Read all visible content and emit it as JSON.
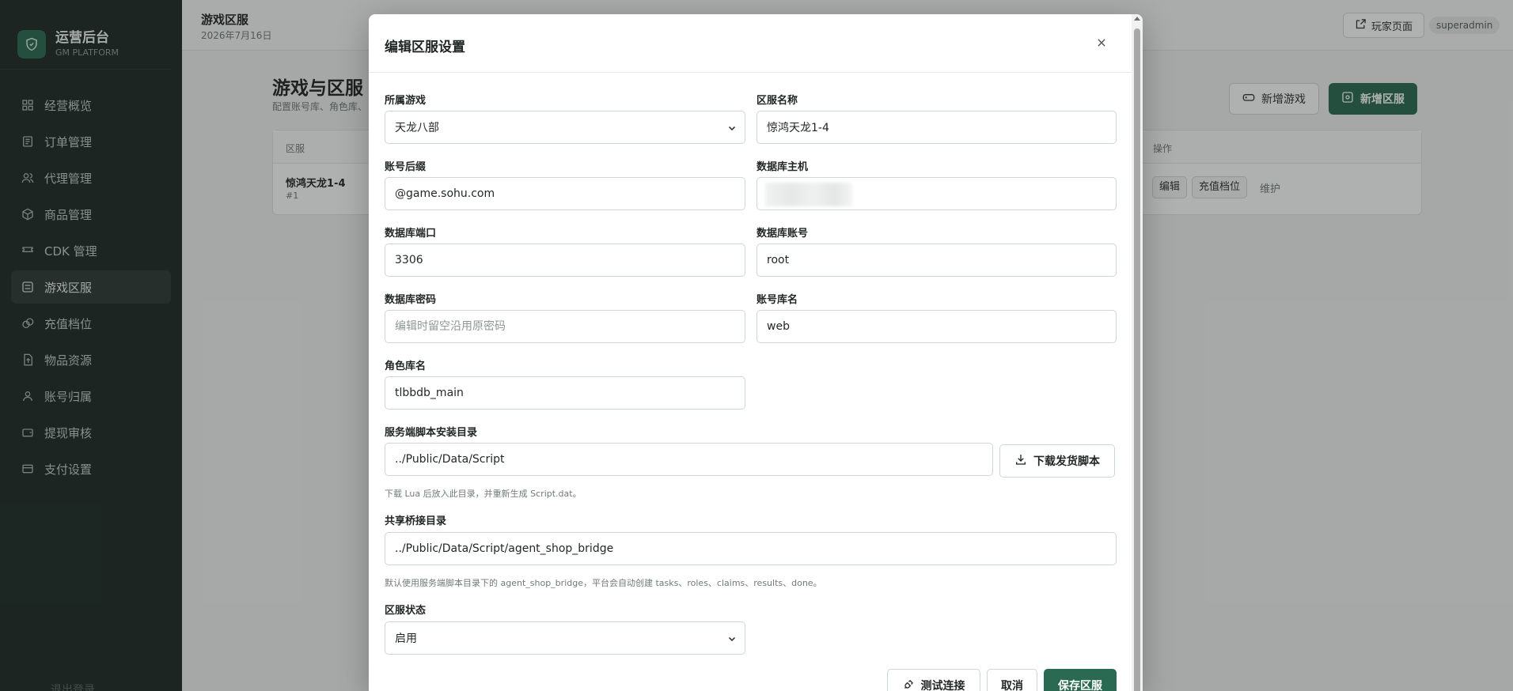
{
  "brand": {
    "title": "运营后台",
    "subtitle": "GM PLATFORM"
  },
  "sidebar": {
    "items": [
      {
        "label": "经营概览",
        "icon": "dashboard-icon"
      },
      {
        "label": "订单管理",
        "icon": "order-icon"
      },
      {
        "label": "代理管理",
        "icon": "users-icon"
      },
      {
        "label": "商品管理",
        "icon": "box-icon"
      },
      {
        "label": "CDK 管理",
        "icon": "ticket-icon"
      },
      {
        "label": "游戏区服",
        "icon": "server-icon",
        "active": true
      },
      {
        "label": "充值档位",
        "icon": "coin-icon"
      },
      {
        "label": "物品资源",
        "icon": "file-icon"
      },
      {
        "label": "账号归属",
        "icon": "user-icon"
      },
      {
        "label": "提现审核",
        "icon": "wallet-icon"
      },
      {
        "label": "支付设置",
        "icon": "card-icon"
      }
    ],
    "logout": "退出登录"
  },
  "header": {
    "title": "游戏区服",
    "date": "2026年7月16日",
    "player_page": "玩家页面",
    "user": "superadmin"
  },
  "page": {
    "title": "游戏与区服",
    "desc": "配置账号库、角色库、",
    "btn_new_game": "新增游戏",
    "btn_new_zone": "新增区服",
    "table": {
      "col_zone": "区服",
      "col_ops": "操作",
      "row": {
        "name": "惊鸿天龙1-4",
        "id": "#1",
        "op_edit": "编辑",
        "op_recharge": "充值档位",
        "op_maintain": "维护"
      }
    }
  },
  "modal": {
    "title": "编辑区服设置",
    "fields": {
      "game": {
        "label": "所属游戏",
        "value": "天龙八部"
      },
      "zone_name": {
        "label": "区服名称",
        "value": "惊鸿天龙1-4"
      },
      "account_suffix": {
        "label": "账号后缀",
        "value": "@game.sohu.com"
      },
      "db_host": {
        "label": "数据库主机",
        "value": ""
      },
      "db_port": {
        "label": "数据库端口",
        "value": "3306"
      },
      "db_user": {
        "label": "数据库账号",
        "value": "root"
      },
      "db_password": {
        "label": "数据库密码",
        "value": "",
        "placeholder": "编辑时留空沿用原密码"
      },
      "account_db": {
        "label": "账号库名",
        "value": "web"
      },
      "role_db": {
        "label": "角色库名",
        "value": "tlbbdb_main"
      },
      "script_dir": {
        "label": "服务端脚本安装目录",
        "value": "../Public/Data/Script",
        "hint": "下载 Lua 后放入此目录，并重新生成 Script.dat。"
      },
      "bridge_dir": {
        "label": "共享桥接目录",
        "value": "../Public/Data/Script/agent_shop_bridge",
        "hint": "默认使用服务端脚本目录下的 agent_shop_bridge，平台会自动创建 tasks、roles、claims、results、done。"
      },
      "status": {
        "label": "区服状态",
        "value": "启用"
      }
    },
    "btn_download": "下载发货脚本",
    "btn_test": "测试连接",
    "btn_cancel": "取消",
    "btn_save": "保存区服"
  },
  "colors": {
    "accent": "#2a6a52",
    "sidebar_bg": "#1e2a25"
  }
}
